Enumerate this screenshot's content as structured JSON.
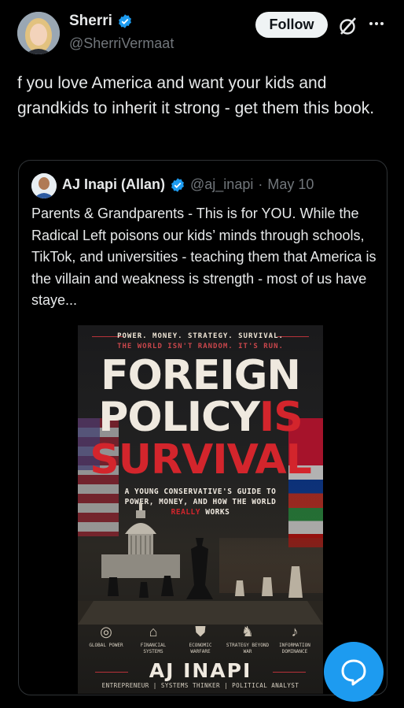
{
  "author": {
    "name": "Sherri",
    "handle": "@SherriVermaat",
    "verified": true,
    "follow_label": "Follow"
  },
  "tweet": {
    "text": "f you love America and want your kids and grandkids to inherit it strong - get them this book."
  },
  "quoted": {
    "name": "AJ Inapi (Allan)",
    "handle": "@aj_inapi",
    "separator": "·",
    "date": "May 10",
    "text": "Parents & Grandparents - This is for YOU. While the Radical Left poisons our kids’ minds through schools, TikTok, and universities - teaching them that America is the villain and weakness is strength - most of us have staye..."
  },
  "book": {
    "tagline1": "POWER. MONEY. STRATEGY. SURVIVAL.",
    "tagline2": "THE WORLD ISN'T RANDOM. IT'S RUN.",
    "title_line1": "FOREIGN",
    "title_line2_a": "POLICY",
    "title_line2_b": "IS",
    "title_line3": "SURVIVAL",
    "subtitle_a": "A YOUNG CONSERVATIVE'S GUIDE TO POWER, MONEY, AND HOW THE WORLD",
    "subtitle_red": "REALLY",
    "subtitle_b": "WORKS",
    "icons": [
      {
        "icon": "globe-icon",
        "glyph": "◎",
        "label": "GLOBAL POWER"
      },
      {
        "icon": "bank-icon",
        "glyph": "⌂",
        "label": "FINANCIAL SYSTEMS"
      },
      {
        "icon": "shield-icon",
        "glyph": "⛊",
        "label": "ECONOMIC WARFARE"
      },
      {
        "icon": "chess-knight-icon",
        "glyph": "♞",
        "label": "STRATEGY BEYOND WAR"
      },
      {
        "icon": "microphone-icon",
        "glyph": "♪",
        "label": "INFORMATION DOMINANCE"
      }
    ],
    "author": "AJ INAPI",
    "roles": "ENTREPRENEUR  |  SYSTEMS THINKER  |  POLITICAL ANALYST"
  },
  "colors": {
    "accent": "#1d9bf0",
    "muted": "#71767b",
    "book_red": "#d3252c"
  }
}
